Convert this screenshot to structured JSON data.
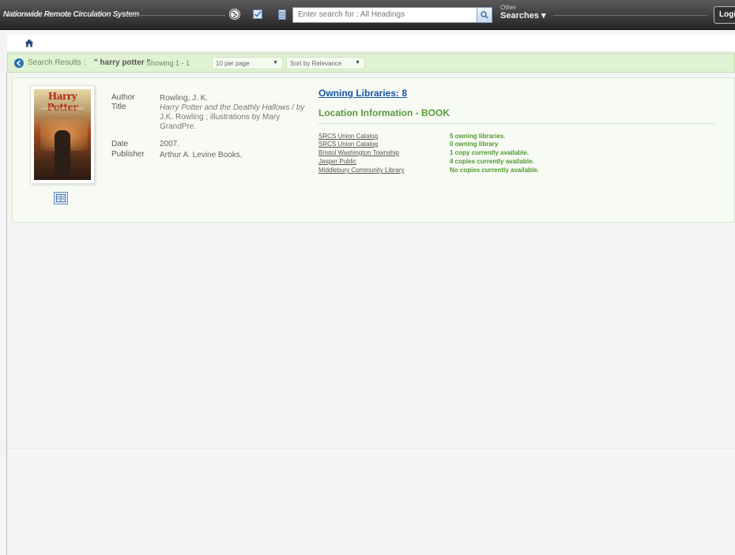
{
  "app": {
    "title": "Nationwide Remote Circulation System"
  },
  "topbar": {
    "search_placeholder": "Enter search for : All Headings",
    "other_small": "Other",
    "other_big": "Searches ▾",
    "login_label": "Login"
  },
  "results": {
    "label": "Search Results : ",
    "query": "\" harry potter \"",
    "showing": "Showing 1 - 1",
    "per_page": "10 per page",
    "sort": "Sort by Relevance"
  },
  "record": {
    "cover_title": "Harry Potter",
    "cover_sub": "and the Deathly Hallows",
    "author_label": "Author",
    "author": "Rowling, J. K.",
    "title_label": "Title",
    "title_main": "Harry Potter and the Deathly Hallows / by",
    "title_stmt": "J.K. Rowling ; illustrations by Mary GrandPre.",
    "date_label": "Date",
    "date": "2007.",
    "publisher_label": "Publisher",
    "publisher": "Arthur A. Levine Books,"
  },
  "holdings": {
    "owning_libraries": "Owning Libraries: 8",
    "location_info": "Location Information - BOOK",
    "libraries": [
      {
        "name": "SRCS Union Catalog",
        "status": "5 owning libraries."
      },
      {
        "name": "SRCS Union Catalog",
        "status": "0 owning library"
      },
      {
        "name": "Bristol Washington Township",
        "status": "1 copy currently available."
      },
      {
        "name": "Jasper Public",
        "status": "4 copies currently available."
      },
      {
        "name": "Middlebury Community Library",
        "status": "No copies currently available."
      }
    ]
  },
  "colors": {
    "topbar": "#333333",
    "results_bar": "#dff2d2",
    "link_blue": "#1a52a8",
    "status_green": "#4f9a2f"
  },
  "icons": [
    "globe-icon",
    "checklist-icon",
    "database-icon",
    "search-icon",
    "home-icon",
    "back-icon",
    "table-of-contents-icon"
  ]
}
